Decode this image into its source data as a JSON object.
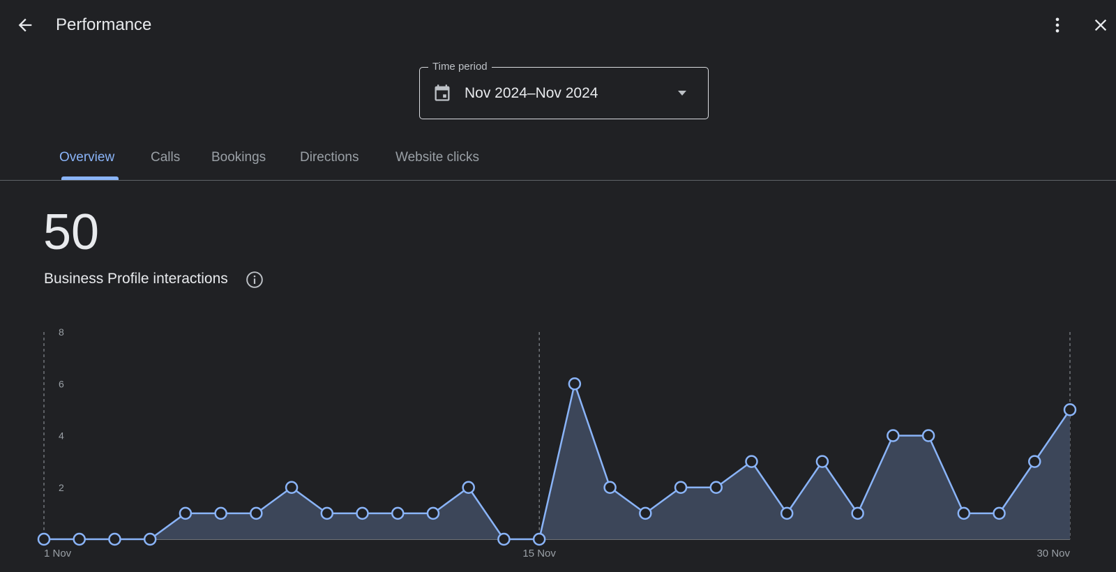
{
  "header": {
    "title": "Performance",
    "back_icon": "arrow-back-icon",
    "more_icon": "more-vert-icon",
    "close_icon": "close-icon"
  },
  "time_period": {
    "label": "Time period",
    "value": "Nov 2024–Nov 2024",
    "icon": "calendar-icon",
    "dropdown_icon": "caret-down-icon"
  },
  "tabs": [
    {
      "label": "Overview",
      "active": true
    },
    {
      "label": "Calls",
      "active": false
    },
    {
      "label": "Bookings",
      "active": false
    },
    {
      "label": "Directions",
      "active": false
    },
    {
      "label": "Website clicks",
      "active": false
    }
  ],
  "summary": {
    "total": "50",
    "label": "Business Profile interactions",
    "info_icon": "info-icon"
  },
  "colors": {
    "background": "#202124",
    "accent": "#8ab4f8",
    "area_fill": "#3c4659",
    "text": "#e8eaed",
    "muted": "#9aa0a6"
  },
  "chart_data": {
    "type": "area",
    "x": [
      "1 Nov",
      "2 Nov",
      "3 Nov",
      "4 Nov",
      "5 Nov",
      "6 Nov",
      "7 Nov",
      "8 Nov",
      "9 Nov",
      "10 Nov",
      "11 Nov",
      "12 Nov",
      "13 Nov",
      "14 Nov",
      "15 Nov",
      "16 Nov",
      "17 Nov",
      "18 Nov",
      "19 Nov",
      "20 Nov",
      "21 Nov",
      "22 Nov",
      "23 Nov",
      "24 Nov",
      "25 Nov",
      "26 Nov",
      "27 Nov",
      "28 Nov",
      "29 Nov",
      "30 Nov"
    ],
    "values": [
      0,
      0,
      0,
      0,
      1,
      1,
      1,
      2,
      1,
      1,
      1,
      1,
      2,
      0,
      0,
      6,
      2,
      1,
      2,
      2,
      3,
      1,
      3,
      1,
      4,
      4,
      1,
      1,
      3,
      5
    ],
    "x_tick_labels": [
      "1 Nov",
      "15 Nov",
      "30 Nov"
    ],
    "x_tick_indices": [
      0,
      14,
      29
    ],
    "y_tick_labels": [
      "2",
      "4",
      "6",
      "8"
    ],
    "y_tick_values": [
      2,
      4,
      6,
      8
    ],
    "ylim": [
      0,
      8
    ],
    "grid": false,
    "legend": "none"
  }
}
